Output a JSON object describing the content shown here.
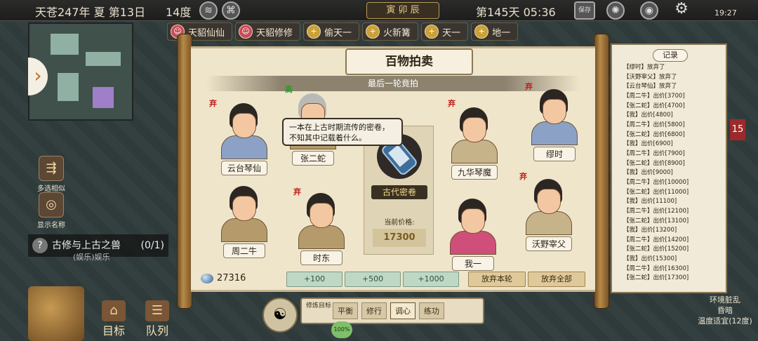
{
  "topbar": {
    "date": "天苍247年 夏 第13日",
    "temperature": "14度",
    "calendar": "寅 卯 辰",
    "day_time": "第145天 05:36",
    "save_label": "保存",
    "clock": "19:27"
  },
  "disciple_tabs": [
    {
      "label": "天貂仙仙"
    },
    {
      "label": "天貂修修"
    },
    {
      "label": "偷天一"
    },
    {
      "label": "火新篝"
    },
    {
      "label": "天一"
    },
    {
      "label": "地一"
    }
  ],
  "left_tools": [
    {
      "label": "多选相似"
    },
    {
      "label": "显示名称"
    }
  ],
  "quest": {
    "title": "古修与上古之兽",
    "progress": "(0/1)",
    "sub": "(娱乐)娱乐"
  },
  "bottom_left": [
    {
      "label": "目标"
    },
    {
      "label": "队列"
    }
  ],
  "bottom_center": {
    "label": "修炼目标",
    "options": [
      "平衡",
      "修行",
      "调心",
      "练功"
    ],
    "selected": "调心",
    "percent": "100%"
  },
  "right_status": [
    "环境脏乱",
    "昏暗",
    "温度适宜(12度)"
  ],
  "right_badge": "15",
  "auction": {
    "title": "百物拍卖",
    "subtitle": "最后一轮竟拍",
    "tooltip": "一本在上古时期流传的密卷，不知其中记载着什么。",
    "item_name": "古代密卷",
    "price_label": "当前价格:",
    "current_price": "17300",
    "spirit_stones": "27316",
    "bid_buttons": [
      "+100",
      "+500",
      "+1000"
    ],
    "skip_round": "放弃本轮",
    "skip_all": "放弃全部",
    "give_up_mark": "弃",
    "high_mark": "高",
    "bidders": [
      {
        "name": "云台琴仙"
      },
      {
        "name": "张二蛇"
      },
      {
        "name": "九华琴魔"
      },
      {
        "name": "缪时"
      },
      {
        "name": "周二牛"
      },
      {
        "name": "时东"
      },
      {
        "name": "我一"
      },
      {
        "name": "沃野宰父"
      }
    ]
  },
  "log": {
    "title": "记录",
    "entries": [
      "【缪时】放弃了",
      "【沃野宰父】放弃了",
      "【云台琴仙】放弃了",
      "【周二牛】出价[3700]",
      "【张二蛇】出价[4700]",
      "【我】出价[4800]",
      "【周二牛】出价[5800]",
      "【张二蛇】出价[6800]",
      "【我】出价[6900]",
      "【周二牛】出价[7900]",
      "【张二蛇】出价[8900]",
      "【我】出价[9000]",
      "【周二牛】出价[10000]",
      "【张二蛇】出价[11000]",
      "【我】出价[11100]",
      "【周二牛】出价[12100]",
      "【张二蛇】出价[13100]",
      "【我】出价[13200]",
      "【周二牛】出价[14200]",
      "【张二蛇】出价[15200]",
      "【我】出价[15300]",
      "【周二牛】出价[16300]",
      "【张二蛇】出价[17300]"
    ]
  }
}
